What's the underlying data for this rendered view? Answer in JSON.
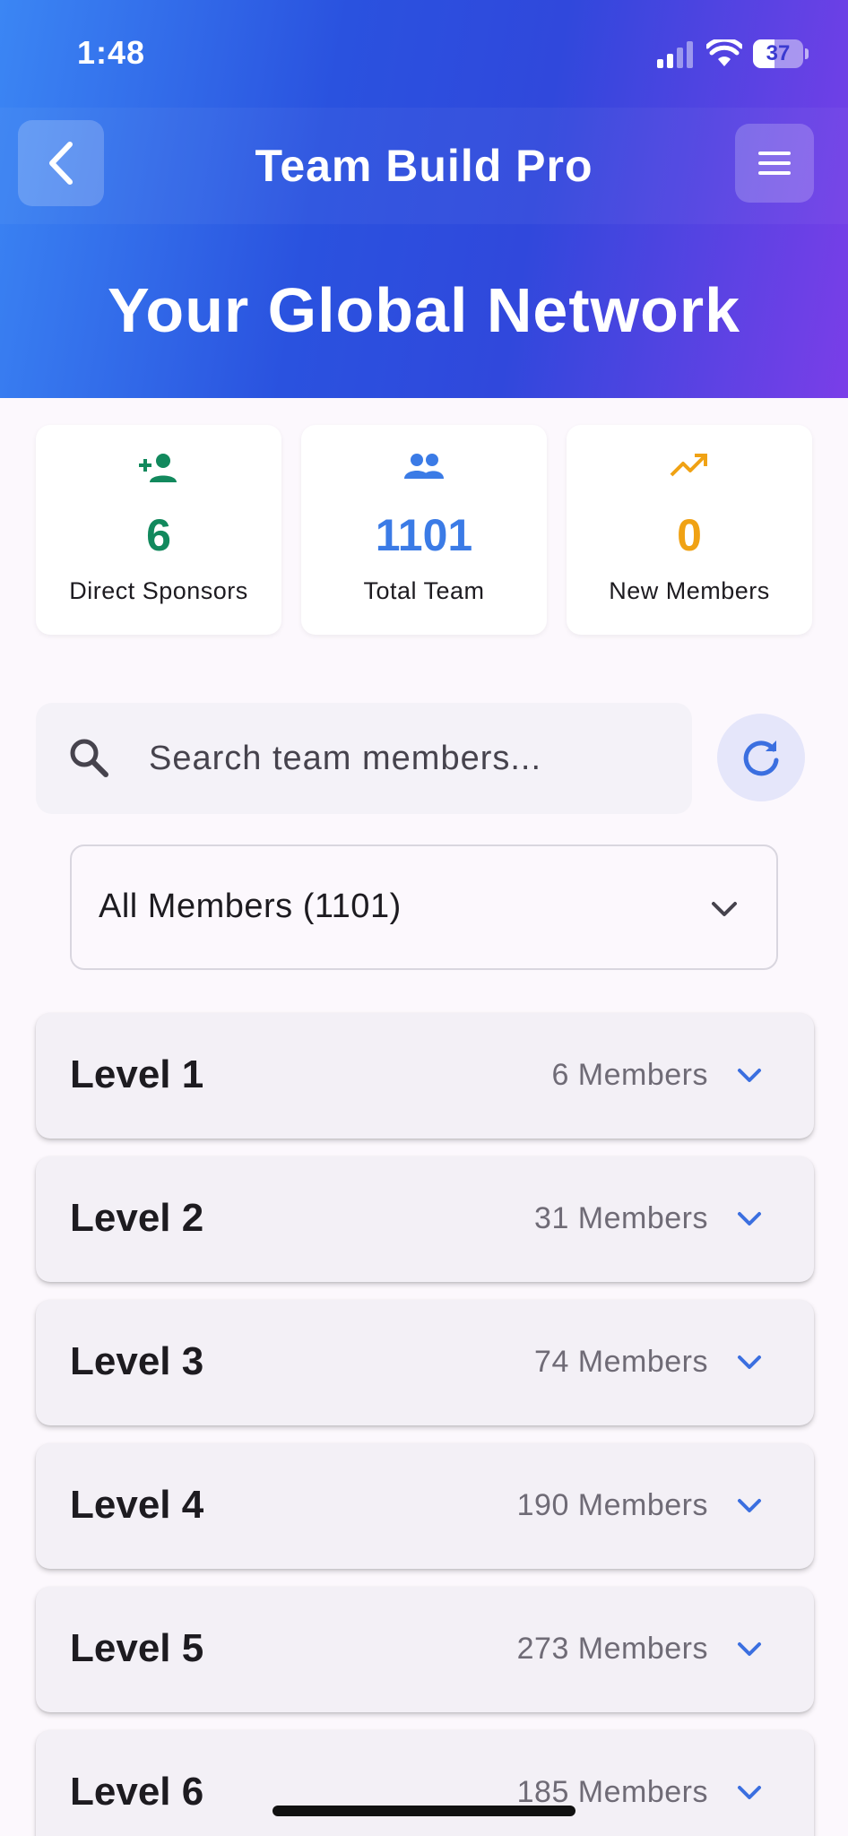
{
  "status_bar": {
    "time": "1:48",
    "battery": "37"
  },
  "app_bar": {
    "title": "Team Build Pro"
  },
  "hero": {
    "title": "Your Global Network"
  },
  "stats": [
    {
      "icon": "person-add-icon",
      "value": "6",
      "label": "Direct Sponsors",
      "color": "#12895d"
    },
    {
      "icon": "group-icon",
      "value": "1101",
      "label": "Total Team",
      "color": "#3b7be6"
    },
    {
      "icon": "trending-up-icon",
      "value": "0",
      "label": "New Members",
      "color": "#f0a214"
    }
  ],
  "search": {
    "placeholder": "Search team members..."
  },
  "filter": {
    "selected": "All Members (1101)"
  },
  "levels": [
    {
      "name": "Level 1",
      "count": "6 Members"
    },
    {
      "name": "Level 2",
      "count": "31 Members"
    },
    {
      "name": "Level 3",
      "count": "74 Members"
    },
    {
      "name": "Level 4",
      "count": "190 Members"
    },
    {
      "name": "Level 5",
      "count": "273 Members"
    },
    {
      "name": "Level 6",
      "count": "185 Members"
    }
  ],
  "colors": {
    "accent": "#3b6fe0",
    "header_start": "#3b86f4",
    "header_end": "#7a3ee8"
  }
}
